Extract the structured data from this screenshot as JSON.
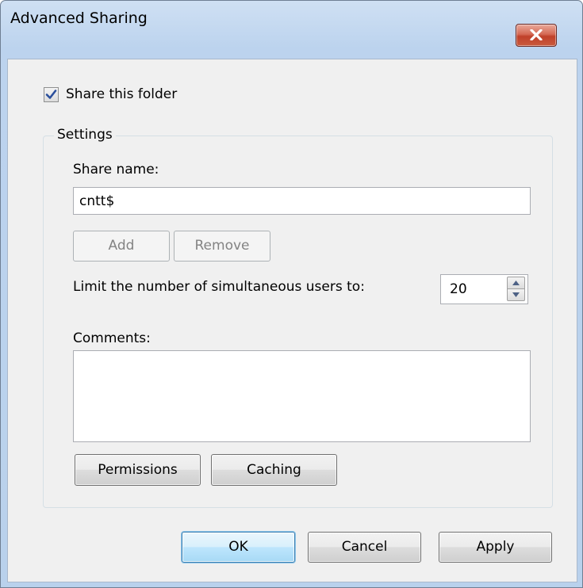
{
  "window": {
    "title": "Advanced Sharing"
  },
  "share_checkbox": {
    "label": "Share this folder",
    "checked": true
  },
  "settings": {
    "legend": "Settings",
    "share_name_label": "Share name:",
    "share_name_value": "cntt$",
    "add_label": "Add",
    "remove_label": "Remove",
    "limit_label": "Limit the number of simultaneous users to:",
    "limit_value": "20",
    "comments_label": "Comments:",
    "comments_value": "",
    "permissions_label": "Permissions",
    "caching_label": "Caching"
  },
  "footer": {
    "ok_label": "OK",
    "cancel_label": "Cancel",
    "apply_label": "Apply"
  },
  "icons": {
    "close": "close-icon",
    "check": "checkmark-icon",
    "spin_up": "arrow-up-icon",
    "spin_down": "arrow-down-icon"
  }
}
